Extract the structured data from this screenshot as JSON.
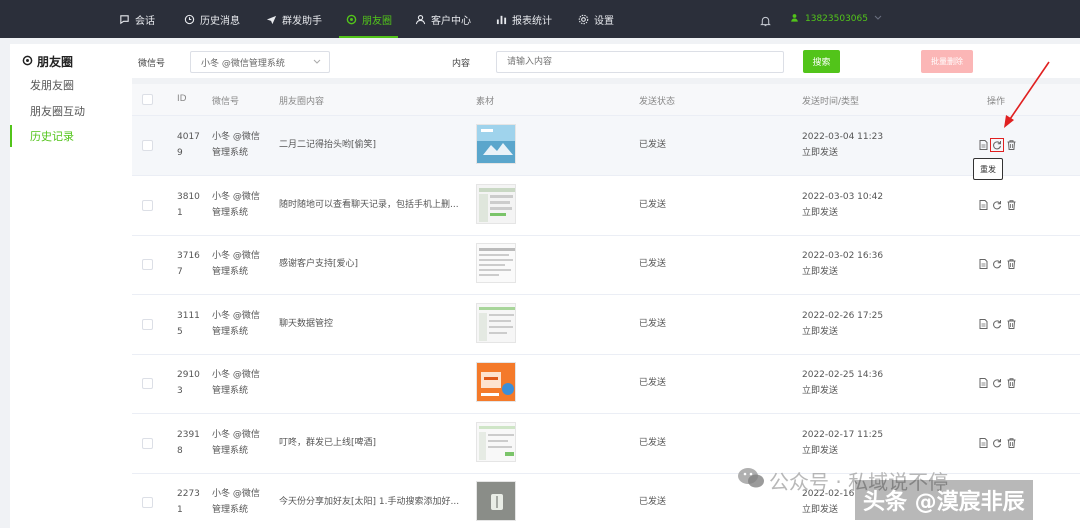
{
  "nav": {
    "items": [
      {
        "label": "会话",
        "icon": "chat-icon"
      },
      {
        "label": "历史消息",
        "icon": "clock-icon"
      },
      {
        "label": "群发助手",
        "icon": "send-icon"
      },
      {
        "label": "朋友圈",
        "icon": "moments-icon",
        "active": true
      },
      {
        "label": "客户中心",
        "icon": "user-icon"
      },
      {
        "label": "报表统计",
        "icon": "bar-chart-icon"
      },
      {
        "label": "设置",
        "icon": "gear-icon"
      }
    ],
    "user": "13823503065"
  },
  "sidebar": {
    "title": "朋友圈",
    "items": [
      {
        "label": "发朋友圈"
      },
      {
        "label": "朋友圈互动"
      },
      {
        "label": "历史记录",
        "active": true
      }
    ]
  },
  "filter": {
    "wechat_label": "微信号",
    "wechat_value": "小冬 @微信管理系统",
    "content_label": "内容",
    "content_placeholder": "请输入内容",
    "search_button": "搜索",
    "batch_delete_button": "批量删除"
  },
  "table": {
    "headers": [
      "ID",
      "微信号",
      "朋友圈内容",
      "素材",
      "发送状态",
      "发送时间/类型",
      "操作"
    ],
    "rows": [
      {
        "id": "40179",
        "wechat": "小冬 @微信管理系统",
        "content": "二月二记得抬头哟[偷笑]",
        "status": "已发送",
        "time": "2022-03-04 11:23",
        "type": "立即发送"
      },
      {
        "id": "38101",
        "wechat": "小冬 @微信管理系统",
        "content": "随时随地可以查看聊天记录，包括手机上删...",
        "status": "已发送",
        "time": "2022-03-03 10:42",
        "type": "立即发送"
      },
      {
        "id": "37167",
        "wechat": "小冬 @微信管理系统",
        "content": "感谢客户支持[爱心]",
        "status": "已发送",
        "time": "2022-03-02 16:36",
        "type": "立即发送"
      },
      {
        "id": "31115",
        "wechat": "小冬 @微信管理系统",
        "content": "聊天数据管控",
        "status": "已发送",
        "time": "2022-02-26 17:25",
        "type": "立即发送"
      },
      {
        "id": "29103",
        "wechat": "小冬 @微信管理系统",
        "content": "",
        "status": "已发送",
        "time": "2022-02-25 14:36",
        "type": "立即发送"
      },
      {
        "id": "23918",
        "wechat": "小冬 @微信管理系统",
        "content": "叮咚，群发已上线[啤酒]",
        "status": "已发送",
        "time": "2022-02-17 11:25",
        "type": "立即发送"
      },
      {
        "id": "22731",
        "wechat": "小冬 @微信管理系统",
        "content": "今天份分享加好友[太阳] 1.手动搜索添加好...",
        "status": "已发送",
        "time": "2022-02-16",
        "type": "立即发送"
      }
    ],
    "tooltip": "重发"
  },
  "watermarks": {
    "gzh": "公众号 · 私域说不停",
    "toutiao": "头条 @漠宸非辰"
  },
  "colors": {
    "accent": "#52c41a",
    "nav_bg": "#2b2f3a",
    "annotation": "#e02020",
    "danger_light": "#fbb6b6"
  }
}
